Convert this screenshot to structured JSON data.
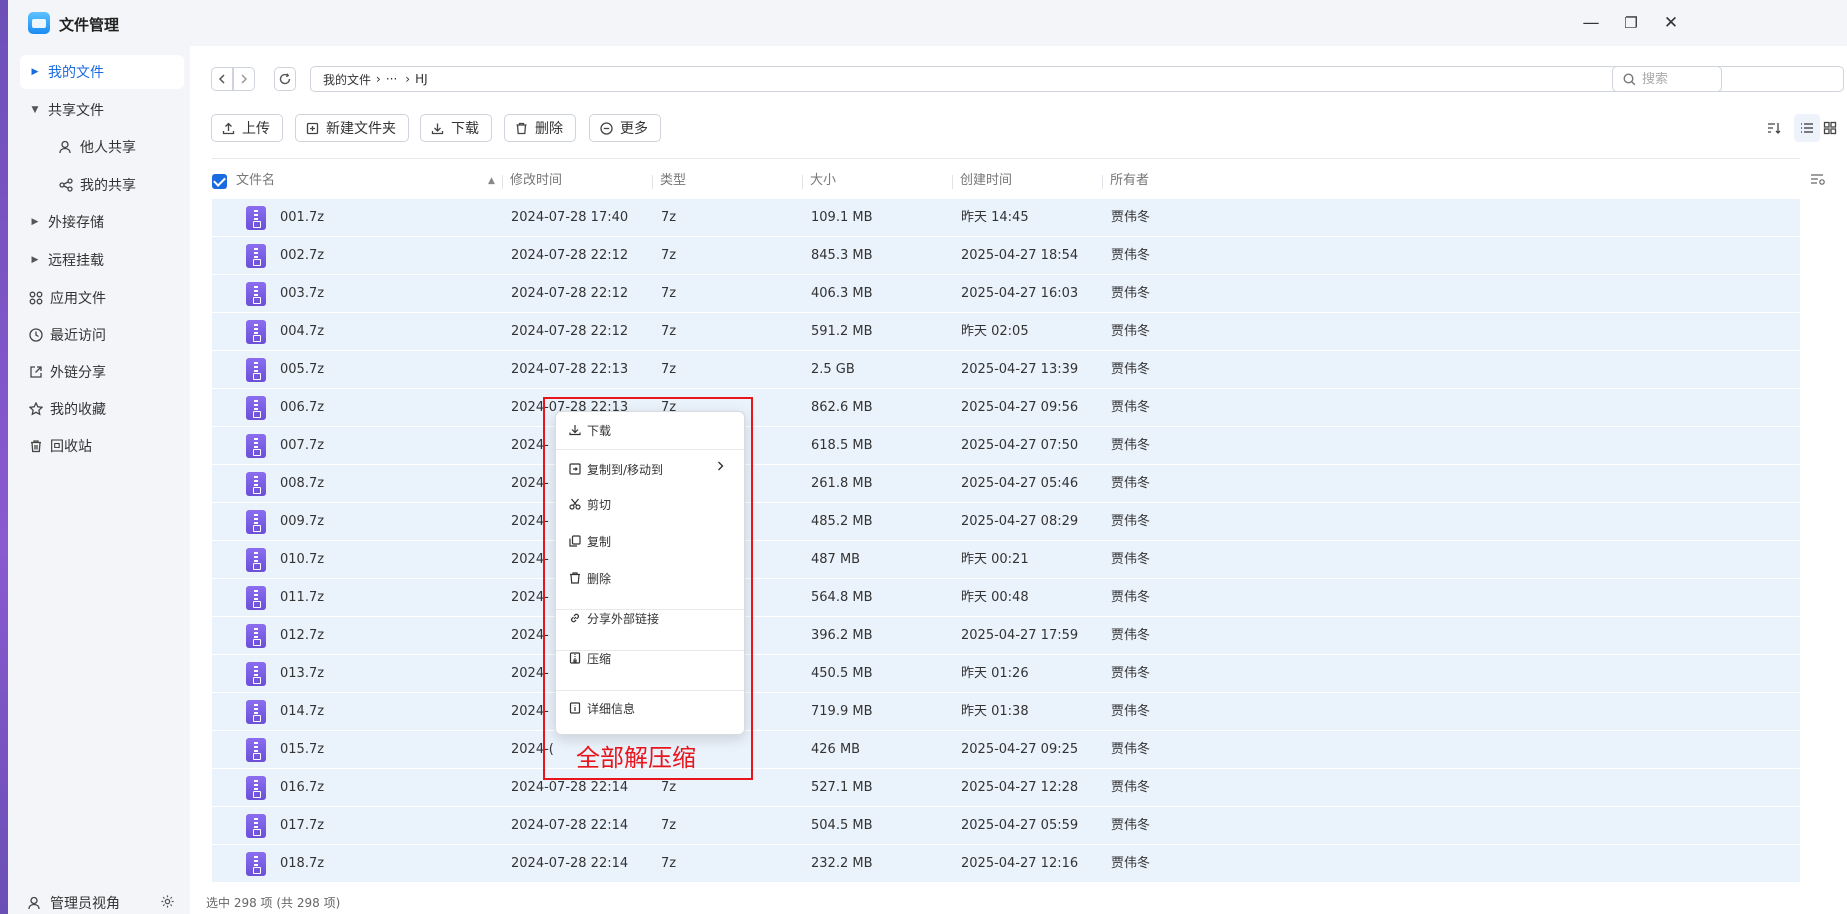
{
  "app": {
    "title": "文件管理"
  },
  "window": {
    "minimize": "—",
    "maximize": "❐",
    "close": "✕"
  },
  "sidebar": {
    "items": [
      {
        "label": "我的文件",
        "icon": "caret-right-icon",
        "active": true
      },
      {
        "label": "共享文件",
        "icon": "caret-down-icon"
      },
      {
        "label": "他人共享",
        "icon": "user-icon",
        "sub": true
      },
      {
        "label": "我的共享",
        "icon": "share-icon",
        "sub": true
      },
      {
        "label": "外接存储",
        "icon": "caret-right-icon"
      },
      {
        "label": "远程挂载",
        "icon": "caret-right-icon"
      },
      {
        "label": "应用文件",
        "icon": "apps-icon"
      },
      {
        "label": "最近访问",
        "icon": "clock-icon"
      },
      {
        "label": "外链分享",
        "icon": "link-share-icon"
      },
      {
        "label": "我的收藏",
        "icon": "star-icon"
      },
      {
        "label": "回收站",
        "icon": "trash-icon"
      }
    ],
    "footer_label": "管理员视角"
  },
  "path": {
    "root": "我的文件",
    "ellipsis": "···",
    "current": "HJ",
    "sep": "›"
  },
  "search": {
    "placeholder": "搜索"
  },
  "toolbar": {
    "upload": "上传",
    "new_folder": "新建文件夹",
    "download": "下载",
    "delete": "删除",
    "more": "更多"
  },
  "columns": {
    "name": "文件名",
    "modified": "修改时间",
    "type": "类型",
    "size": "大小",
    "created": "创建时间",
    "owner": "所有者"
  },
  "files": [
    {
      "name": "001.7z",
      "modified": "2024-07-28 17:40",
      "type": "7z",
      "size": "109.1 MB",
      "created": "昨天 14:45",
      "owner": "贾伟冬"
    },
    {
      "name": "002.7z",
      "modified": "2024-07-28 22:12",
      "type": "7z",
      "size": "845.3 MB",
      "created": "2025-04-27 18:54",
      "owner": "贾伟冬"
    },
    {
      "name": "003.7z",
      "modified": "2024-07-28 22:12",
      "type": "7z",
      "size": "406.3 MB",
      "created": "2025-04-27 16:03",
      "owner": "贾伟冬"
    },
    {
      "name": "004.7z",
      "modified": "2024-07-28 22:12",
      "type": "7z",
      "size": "591.2 MB",
      "created": "昨天 02:05",
      "owner": "贾伟冬"
    },
    {
      "name": "005.7z",
      "modified": "2024-07-28 22:13",
      "type": "7z",
      "size": "2.5 GB",
      "created": "2025-04-27 13:39",
      "owner": "贾伟冬"
    },
    {
      "name": "006.7z",
      "modified": "2024-07-28 22:13",
      "type": "7z",
      "size": "862.6 MB",
      "created": "2025-04-27 09:56",
      "owner": "贾伟冬"
    },
    {
      "name": "007.7z",
      "modified": "2024-",
      "type": "",
      "size": "618.5 MB",
      "created": "2025-04-27 07:50",
      "owner": "贾伟冬"
    },
    {
      "name": "008.7z",
      "modified": "2024-",
      "type": "",
      "size": "261.8 MB",
      "created": "2025-04-27 05:46",
      "owner": "贾伟冬"
    },
    {
      "name": "009.7z",
      "modified": "2024-",
      "type": "",
      "size": "485.2 MB",
      "created": "2025-04-27 08:29",
      "owner": "贾伟冬"
    },
    {
      "name": "010.7z",
      "modified": "2024-",
      "type": "",
      "size": "487 MB",
      "created": "昨天 00:21",
      "owner": "贾伟冬"
    },
    {
      "name": "011.7z",
      "modified": "2024-",
      "type": "",
      "size": "564.8 MB",
      "created": "昨天 00:48",
      "owner": "贾伟冬"
    },
    {
      "name": "012.7z",
      "modified": "2024-",
      "type": "",
      "size": "396.2 MB",
      "created": "2025-04-27 17:59",
      "owner": "贾伟冬"
    },
    {
      "name": "013.7z",
      "modified": "2024-",
      "type": "",
      "size": "450.5 MB",
      "created": "昨天 01:26",
      "owner": "贾伟冬"
    },
    {
      "name": "014.7z",
      "modified": "2024-",
      "type": "",
      "size": "719.9 MB",
      "created": "昨天 01:38",
      "owner": "贾伟冬"
    },
    {
      "name": "015.7z",
      "modified": "2024-(",
      "type": "",
      "size": "426 MB",
      "created": "2025-04-27 09:25",
      "owner": "贾伟冬"
    },
    {
      "name": "016.7z",
      "modified": "2024-07-28 22:14",
      "type": "7z",
      "size": "527.1 MB",
      "created": "2025-04-27 12:28",
      "owner": "贾伟冬"
    },
    {
      "name": "017.7z",
      "modified": "2024-07-28 22:14",
      "type": "7z",
      "size": "504.5 MB",
      "created": "2025-04-27 05:59",
      "owner": "贾伟冬"
    },
    {
      "name": "018.7z",
      "modified": "2024-07-28 22:14",
      "type": "7z",
      "size": "232.2 MB",
      "created": "2025-04-27 12:16",
      "owner": "贾伟冬"
    }
  ],
  "context_menu": {
    "download": "下载",
    "copy_move": "复制到/移动到",
    "cut": "剪切",
    "copy": "复制",
    "delete": "删除",
    "share_link": "分享外部链接",
    "compress": "压缩",
    "details": "详细信息"
  },
  "annotation": "全部解压缩",
  "status": "选中 298 项 (共 298 项)",
  "colors": {
    "accent": "#1a6ae0",
    "selected_row": "#eaf2fc",
    "annotation": "#e8151b",
    "file_icon": "#7a5ee6"
  }
}
